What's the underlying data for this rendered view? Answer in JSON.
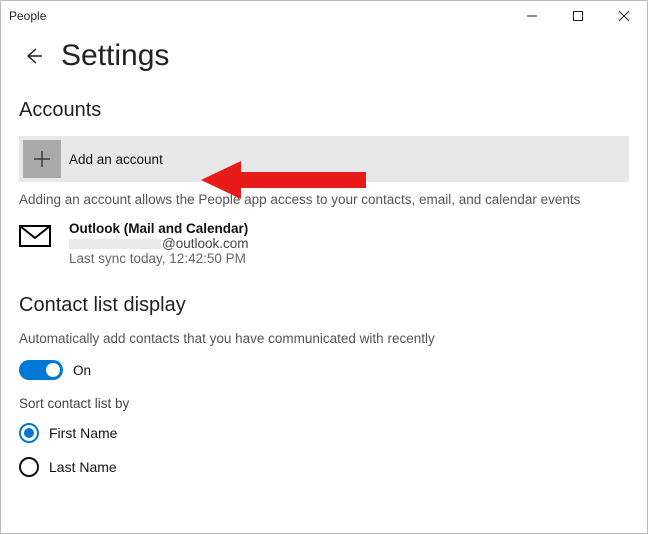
{
  "window": {
    "title": "People"
  },
  "header": {
    "page_title": "Settings"
  },
  "accounts": {
    "heading": "Accounts",
    "add_label": "Add an account",
    "description": "Adding an account allows the People app access to your contacts, email, and calendar events",
    "item": {
      "title": "Outlook (Mail and Calendar)",
      "email_suffix": "@outlook.com",
      "sync": "Last sync today, 12:42:50 PM"
    }
  },
  "contact_display": {
    "heading": "Contact list display",
    "auto_add_label": "Automatically add contacts that you have communicated with recently",
    "toggle_state": "On",
    "sort_label": "Sort contact list by",
    "options": {
      "first": "First Name",
      "last": "Last Name"
    },
    "selected": "first"
  },
  "colors": {
    "accent": "#0078D7",
    "annotation": "#E81B1B"
  }
}
